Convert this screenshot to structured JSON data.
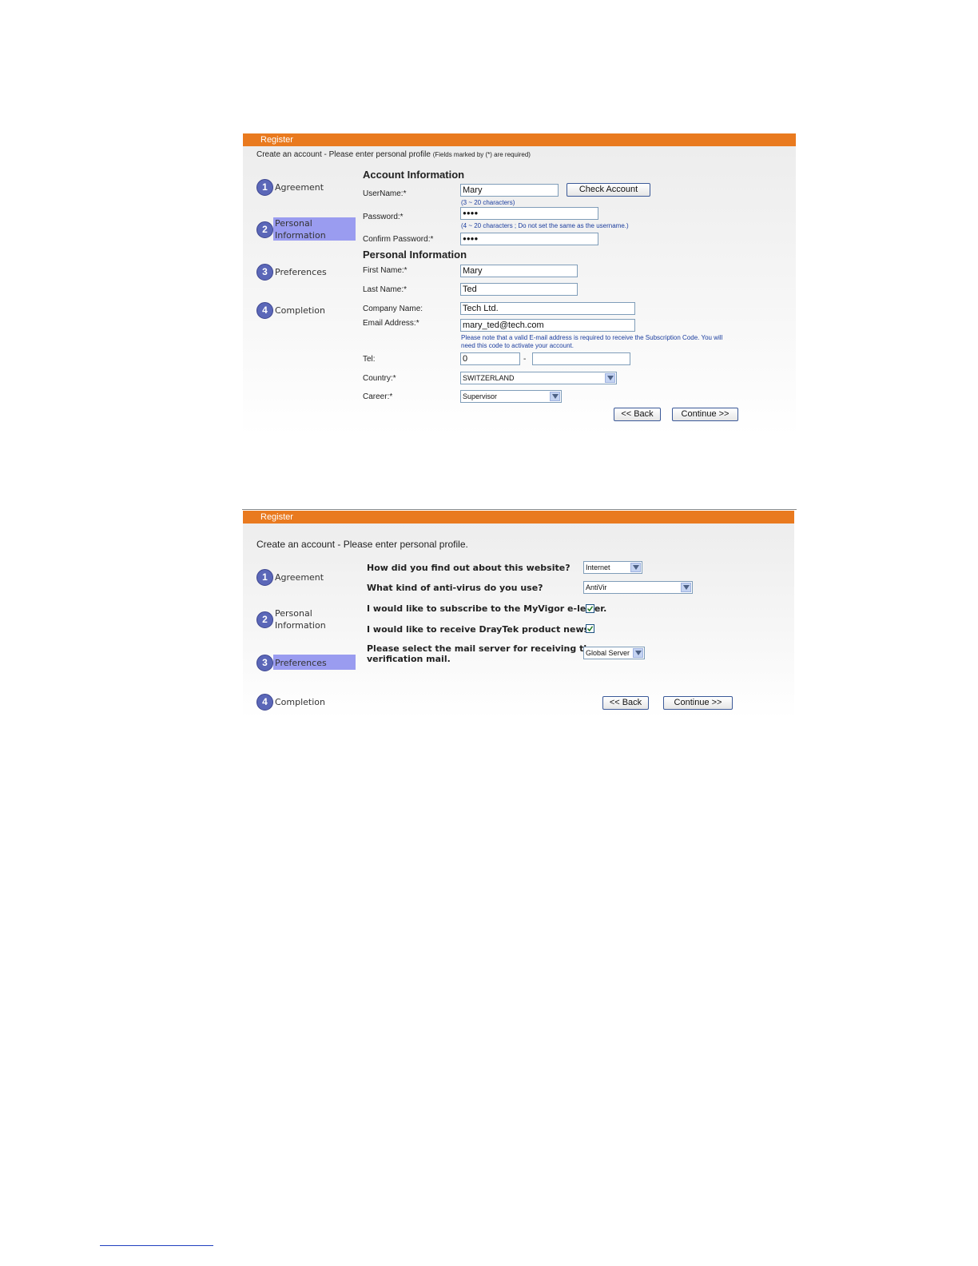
{
  "panel1": {
    "header": "Register",
    "intro": "Create an account - Please enter personal profile",
    "intro_note": "(Fields marked by (*) are required)",
    "steps": [
      {
        "num": "1",
        "label": "Agreement"
      },
      {
        "num": "2",
        "label": "Personal Information",
        "line1": "Personal",
        "line2": "Information",
        "active": true
      },
      {
        "num": "3",
        "label": "Preferences"
      },
      {
        "num": "4",
        "label": "Completion"
      }
    ],
    "account_section": "Account Information",
    "username_label": "UserName:*",
    "username_value": "Mary",
    "username_hint": "(3 ~ 20 characters)",
    "check_account": "Check Account",
    "password_label": "Password:*",
    "password_value": "●●●●",
    "password_hint": "(4 ~ 20 characters ; Do not set the same as the username.)",
    "confirm_label": "Confirm Password:*",
    "confirm_value": "●●●●",
    "personal_section": "Personal Information",
    "first_name_label": "First Name:*",
    "first_name_value": "Mary",
    "last_name_label": "Last Name:*",
    "last_name_value": "Ted",
    "company_label": "Company Name:",
    "company_value": "Tech Ltd.",
    "email_label": "Email Address:*",
    "email_value": "mary_ted@tech.com",
    "email_note_1": "Please note that a valid E-mail address is required to receive the Subscription Code. You will",
    "email_note_2": "need this code to activate your account.",
    "tel_label": "Tel:",
    "tel_area": "0",
    "tel_sep": "-",
    "tel_number": "",
    "country_label": "Country:*",
    "country_value": "SWITZERLAND",
    "career_label": "Career:*",
    "career_value": "Supervisor",
    "back": "<< Back",
    "continue": "Continue >>"
  },
  "panel2": {
    "header": "Register",
    "intro": "Create an account - Please enter personal profile.",
    "steps": [
      {
        "num": "1",
        "label": "Agreement"
      },
      {
        "num": "2",
        "label": "Personal Information",
        "line1": "Personal",
        "line2": "Information"
      },
      {
        "num": "3",
        "label": "Preferences",
        "active": true
      },
      {
        "num": "4",
        "label": "Completion"
      }
    ],
    "q_find": "How did you find out about this website?",
    "find_value": "Internet",
    "q_antivirus": "What kind of anti-virus do you use?",
    "antivirus_value": "AntiVir",
    "q_eletter": "I would like to subscribe to the MyVigor e-letter.",
    "eletter_checked": true,
    "q_news": "I would like to receive DrayTek product news.",
    "news_checked": true,
    "q_mail_1": "Please select the mail server for receiving the",
    "q_mail_2": "verification mail.",
    "mail_value": "Global Server",
    "back": "<< Back",
    "continue": "Continue >>"
  }
}
